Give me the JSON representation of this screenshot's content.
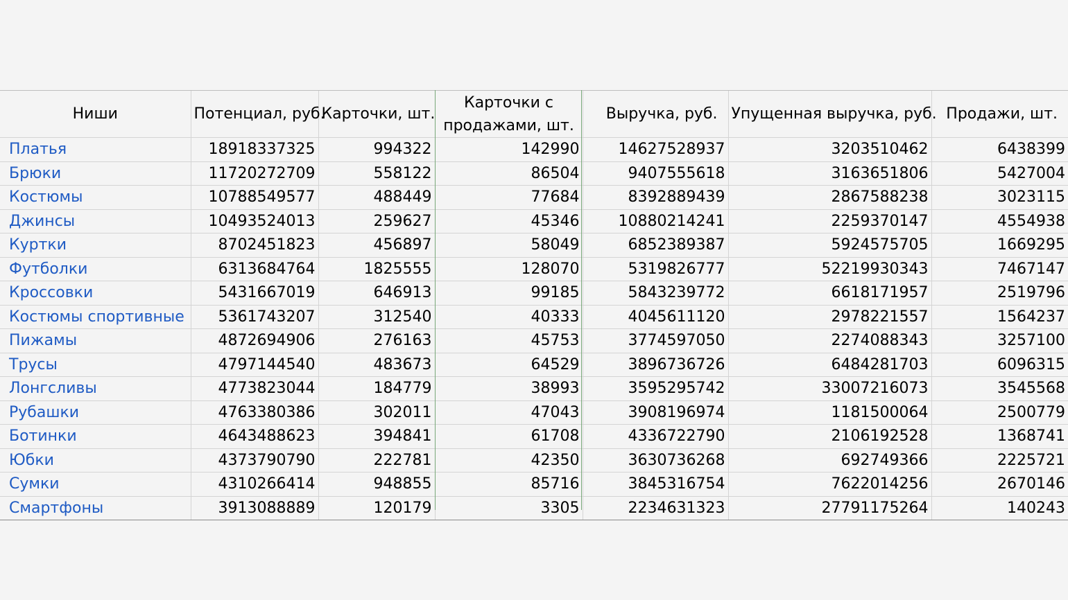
{
  "table": {
    "headers": [
      "Ниши",
      "Потенциал, руб.",
      "Карточки, шт.",
      "Карточки с продажами, шт.",
      "Выручка, руб.",
      "Упущенная выручка, руб.",
      "Продажи, шт."
    ],
    "rows": [
      [
        "Платья",
        "18918337325",
        "994322",
        "142990",
        "14627528937",
        "3203510462",
        "6438399"
      ],
      [
        "Брюки",
        "11720272709",
        "558122",
        "86504",
        "9407555618",
        "3163651806",
        "5427004"
      ],
      [
        "Костюмы",
        "10788549577",
        "488449",
        "77684",
        "8392889439",
        "2867588238",
        "3023115"
      ],
      [
        "Джинсы",
        "10493524013",
        "259627",
        "45346",
        "10880214241",
        "2259370147",
        "4554938"
      ],
      [
        "Куртки",
        "8702451823",
        "456897",
        "58049",
        "6852389387",
        "5924575705",
        "1669295"
      ],
      [
        "Футболки",
        "6313684764",
        "1825555",
        "128070",
        "5319826777",
        "52219930343",
        "7467147"
      ],
      [
        "Кроссовки",
        "5431667019",
        "646913",
        "99185",
        "5843239772",
        "6618171957",
        "2519796"
      ],
      [
        "Костюмы спортивные",
        "5361743207",
        "312540",
        "40333",
        "4045611120",
        "2978221557",
        "1564237"
      ],
      [
        "Пижамы",
        "4872694906",
        "276163",
        "45753",
        "3774597050",
        "2274088343",
        "3257100"
      ],
      [
        "Трусы",
        "4797144540",
        "483673",
        "64529",
        "3896736726",
        "6484281703",
        "6096315"
      ],
      [
        "Лонгсливы",
        "4773823044",
        "184779",
        "38993",
        "3595295742",
        "33007216073",
        "3545568"
      ],
      [
        "Рубашки",
        "4763380386",
        "302011",
        "47043",
        "3908196974",
        "1181500064",
        "2500779"
      ],
      [
        "Ботинки",
        "4643488623",
        "394841",
        "61708",
        "4336722790",
        "2106192528",
        "1368741"
      ],
      [
        "Юбки",
        "4373790790",
        "222781",
        "42350",
        "3630736268",
        "692749366",
        "2225721"
      ],
      [
        "Сумки",
        "4310266414",
        "948855",
        "85716",
        "3845316754",
        "7622014256",
        "2670146"
      ],
      [
        "Смартфоны",
        "3913088889",
        "120179",
        "3305",
        "2234631323",
        "27791175264",
        "140243"
      ]
    ]
  },
  "colors": {
    "link": "#1f5bc4",
    "selection": "#78a879",
    "background": "#f4f4f4"
  }
}
